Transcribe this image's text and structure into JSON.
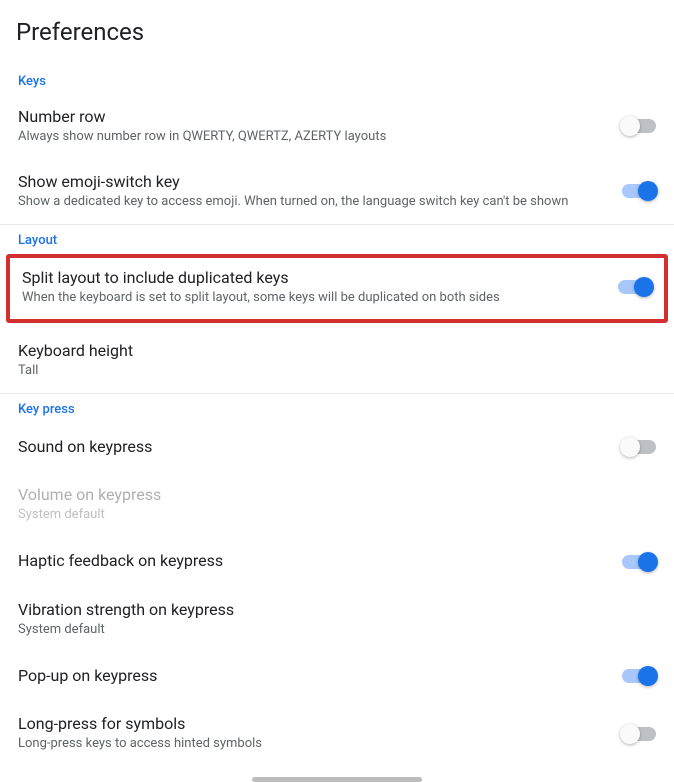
{
  "page_title": "Preferences",
  "sections": {
    "keys": {
      "header": "Keys",
      "number_row": {
        "title": "Number row",
        "subtitle": "Always show number row in QWERTY, QWERTZ, AZERTY layouts"
      },
      "emoji_switch": {
        "title": "Show emoji-switch key",
        "subtitle": "Show a dedicated key to access emoji. When turned on, the language switch key can't be shown"
      }
    },
    "layout": {
      "header": "Layout",
      "split_layout": {
        "title": "Split layout to include duplicated keys",
        "subtitle": "When the keyboard is set to split layout, some keys will be duplicated on both sides"
      },
      "keyboard_height": {
        "title": "Keyboard height",
        "subtitle": "Tall"
      }
    },
    "key_press": {
      "header": "Key press",
      "sound": {
        "title": "Sound on keypress"
      },
      "volume": {
        "title": "Volume on keypress",
        "subtitle": "System default"
      },
      "haptic": {
        "title": "Haptic feedback on keypress"
      },
      "vibration": {
        "title": "Vibration strength on keypress",
        "subtitle": "System default"
      },
      "popup": {
        "title": "Pop-up on keypress"
      },
      "long_press": {
        "title": "Long-press for symbols",
        "subtitle": "Long-press keys to access hinted symbols"
      }
    }
  }
}
